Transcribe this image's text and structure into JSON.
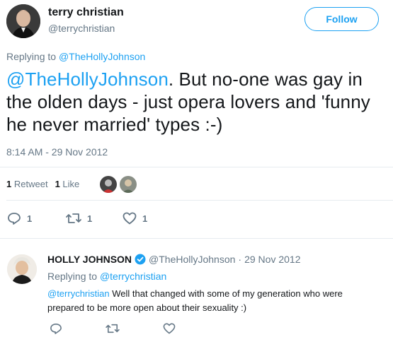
{
  "tweet": {
    "author_name": "terry christian",
    "author_handle": "@terrychristian",
    "follow_label": "Follow",
    "replying_prefix": "Replying to",
    "replying_to": "@TheHollyJohnson",
    "mention": "@TheHollyJohnson",
    "text": ". But no-one was gay in the olden days - just opera lovers and 'funny he never married' types :-)",
    "timestamp": "8:14 AM - 29 Nov 2012",
    "retweet_count": "1",
    "retweet_label": "Retweet",
    "like_count": "1",
    "like_label": "Like",
    "actions": {
      "reply_count": "1",
      "retweet_count": "1",
      "like_count": "1"
    }
  },
  "reply": {
    "author_name": "HOLLY JOHNSON",
    "author_handle": "@TheHollyJohnson",
    "separator": "·",
    "date": "29 Nov 2012",
    "replying_prefix": "Replying to",
    "replying_to": "@terrychristian",
    "mention": "@terrychristian",
    "text": " Well that changed with some of my generation who were prepared to be more open about their sexuality :)"
  },
  "colors": {
    "accent": "#1da1f2",
    "muted": "#657786",
    "text": "#14171a",
    "divider": "#e6ecf0"
  },
  "icons": [
    "reply-icon",
    "retweet-icon",
    "heart-icon",
    "verified-badge-icon"
  ]
}
